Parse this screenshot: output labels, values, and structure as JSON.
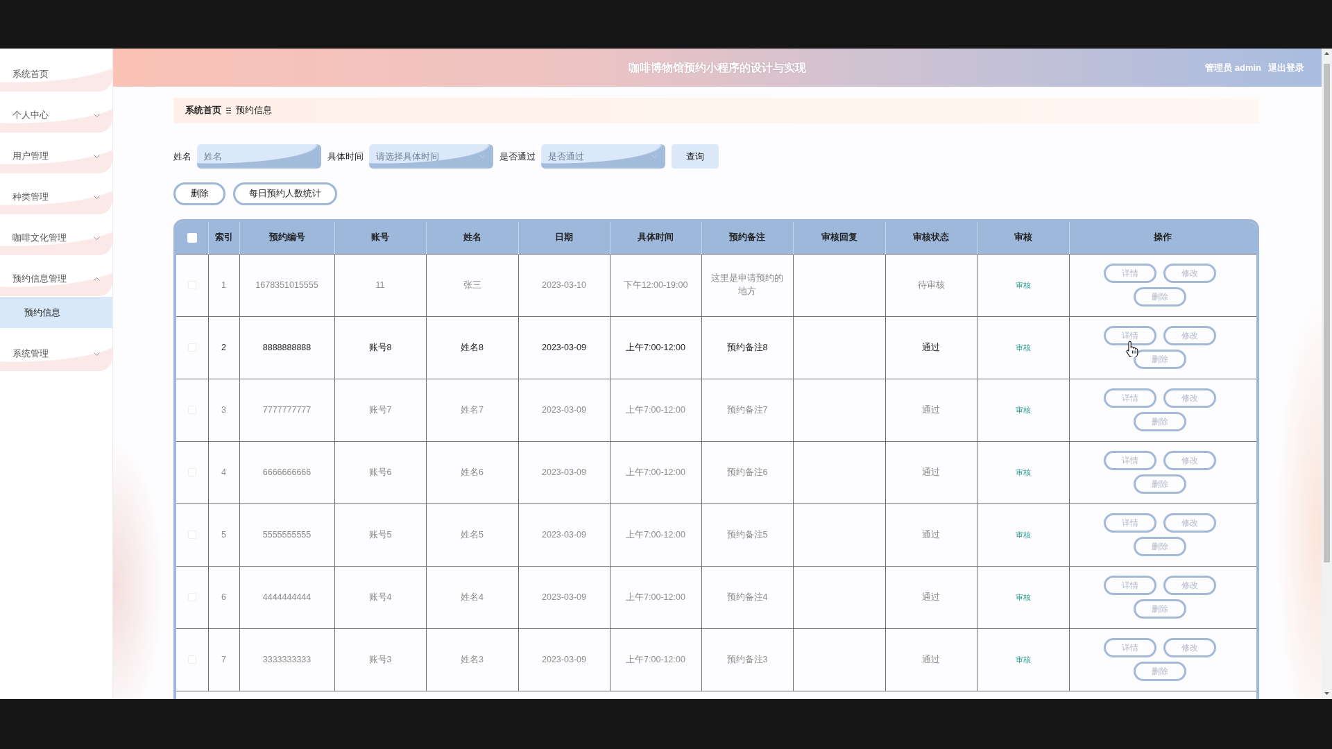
{
  "header": {
    "title": "咖啡博物馆预约小程序的设计与实现",
    "user": "管理员 admin",
    "logout": "退出登录"
  },
  "sidebar": {
    "items": [
      {
        "label": "系统首页"
      },
      {
        "label": "个人中心",
        "expanded": false
      },
      {
        "label": "用户管理",
        "expanded": false
      },
      {
        "label": "种类管理",
        "expanded": false
      },
      {
        "label": "咖啡文化管理",
        "expanded": false
      },
      {
        "label": "预约信息管理",
        "expanded": true,
        "children": [
          {
            "label": "预约信息",
            "selected": true
          }
        ]
      },
      {
        "label": "系统管理",
        "expanded": false
      }
    ]
  },
  "breadcrumb": [
    "系统首页",
    "预约信息"
  ],
  "filters": [
    {
      "kind": "input",
      "label": "姓名",
      "placeholder": "姓名"
    },
    {
      "kind": "select",
      "label": "具体时间",
      "placeholder": "请选择具体时间"
    },
    {
      "kind": "select",
      "label": "是否通过",
      "placeholder": "是否通过"
    }
  ],
  "search_button": "查询",
  "actions": [
    "删除",
    "每日预约人数统计"
  ],
  "table": {
    "select_all": {
      "checked": false
    },
    "columns": [
      "索引",
      "预约编号",
      "账号",
      "姓名",
      "日期",
      "具体时间",
      "预约备注",
      "审核回复",
      "审核状态",
      "审核",
      "操作"
    ],
    "rows": [
      {
        "checked": false,
        "hovered": false,
        "index": "1",
        "booking_no": "1678351015555",
        "account": "11",
        "name": "张三",
        "date": "2023-03-10",
        "time": "下午12:00-19:00",
        "note": "这里是申请预约的地方",
        "status": "待审核",
        "review": "审核",
        "actions": [
          "详情",
          "修改",
          "删除"
        ]
      },
      {
        "checked": false,
        "hovered": true,
        "index": "2",
        "booking_no": "8888888888",
        "account": "账号8",
        "name": "姓名8",
        "date": "2023-03-09",
        "time": "上午7:00-12:00",
        "note": "预约备注8",
        "status": "通过",
        "review": "审核",
        "actions": [
          "详情",
          "修改",
          "删除"
        ]
      },
      {
        "checked": false,
        "hovered": false,
        "index": "3",
        "booking_no": "7777777777",
        "account": "账号7",
        "name": "姓名7",
        "date": "2023-03-09",
        "time": "上午7:00-12:00",
        "note": "预约备注7",
        "status": "通过",
        "review": "审核",
        "actions": [
          "详情",
          "修改",
          "删除"
        ]
      },
      {
        "checked": false,
        "hovered": false,
        "index": "4",
        "booking_no": "6666666666",
        "account": "账号6",
        "name": "姓名6",
        "date": "2023-03-09",
        "time": "上午7:00-12:00",
        "note": "预约备注6",
        "status": "通过",
        "review": "审核",
        "actions": [
          "详情",
          "修改",
          "删除"
        ]
      },
      {
        "checked": false,
        "hovered": false,
        "index": "5",
        "booking_no": "5555555555",
        "account": "账号5",
        "name": "姓名5",
        "date": "2023-03-09",
        "time": "上午7:00-12:00",
        "note": "预约备注5",
        "status": "通过",
        "review": "审核",
        "actions": [
          "详情",
          "修改",
          "删除"
        ]
      },
      {
        "checked": false,
        "hovered": false,
        "index": "6",
        "booking_no": "4444444444",
        "account": "账号4",
        "name": "姓名4",
        "date": "2023-03-09",
        "time": "上午7:00-12:00",
        "note": "预约备注4",
        "status": "通过",
        "review": "审核",
        "actions": [
          "详情",
          "修改",
          "删除"
        ]
      },
      {
        "checked": false,
        "hovered": false,
        "index": "7",
        "booking_no": "3333333333",
        "account": "账号3",
        "name": "姓名3",
        "date": "2023-03-09",
        "time": "上午7:00-12:00",
        "note": "预约备注3",
        "status": "通过",
        "review": "审核",
        "actions": [
          "详情",
          "修改",
          "删除"
        ]
      }
    ]
  }
}
